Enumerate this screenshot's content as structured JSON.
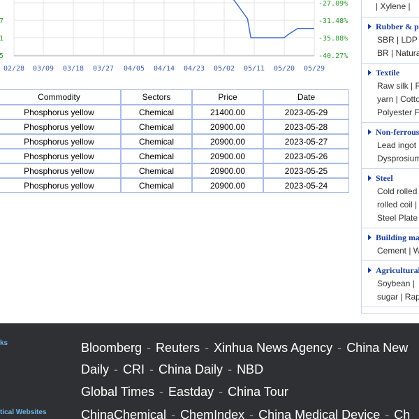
{
  "chart_data": {
    "type": "line",
    "x_ticks": [
      "02/28",
      "03/09",
      "03/18",
      "03/27",
      "04/05",
      "04/14",
      "04/23",
      "05/02",
      "05/11",
      "05/20",
      "05/29"
    ],
    "y_ticks": [
      "-27.09%",
      "-31.48%",
      "-35.88%",
      "-40.27%"
    ],
    "y_left_partial": [
      "7",
      "1",
      "5"
    ],
    "ylim": [
      -40.27,
      -27.09
    ],
    "series": [
      {
        "color": "#3f6fc9",
        "points": [
          {
            "x": "05/02",
            "y": -23.0
          },
          {
            "x": "05/09",
            "y": -31.1
          },
          {
            "x": "05/10",
            "y": -35.88
          },
          {
            "x": "05/20",
            "y": -35.88
          },
          {
            "x": "05/21",
            "y": -35.2
          },
          {
            "x": "05/24",
            "y": -33.55
          },
          {
            "x": "05/29",
            "y": -33.55
          }
        ]
      }
    ]
  },
  "table": {
    "headers": [
      "Commodity",
      "Sectors",
      "Price",
      "Date"
    ],
    "rows": [
      [
        "Phosphorus yellow",
        "Chemical",
        "21400.00",
        "2023-05-29"
      ],
      [
        "Phosphorus yellow",
        "Chemical",
        "20900.00",
        "2023-05-28"
      ],
      [
        "Phosphorus yellow",
        "Chemical",
        "20900.00",
        "2023-05-27"
      ],
      [
        "Phosphorus yellow",
        "Chemical",
        "20900.00",
        "2023-05-26"
      ],
      [
        "Phosphorus yellow",
        "Chemical",
        "20900.00",
        "2023-05-25"
      ],
      [
        "Phosphorus yellow",
        "Chemical",
        "20900.00",
        "2023-05-24"
      ]
    ]
  },
  "sidebar": {
    "top_line": "| Xylene |",
    "sections": [
      {
        "title": "Rubber & pl",
        "lines": [
          "SBR | LDP",
          "BR | Natura"
        ]
      },
      {
        "title": "Textile",
        "lines": [
          "Raw silk | F",
          "yarn | Cotto",
          "Polyester Fi"
        ]
      },
      {
        "title": "Non-ferrous",
        "lines": [
          "Lead ingot",
          "Dysprosium"
        ]
      },
      {
        "title": "Steel",
        "lines": [
          "Cold rolled s",
          "rolled coil |",
          "Steel Plate"
        ]
      },
      {
        "title": "Building ma",
        "lines": [
          "Cement | W"
        ]
      },
      {
        "title": "Agricultural",
        "lines": [
          "Soybean |",
          "sugar | Rap"
        ]
      }
    ]
  },
  "footer": {
    "label1": "ks",
    "label2": "tical Websites",
    "row1": [
      "Bloomberg",
      "Reuters",
      "Xinhua News Agency",
      "China New"
    ],
    "row2": [
      "Daily",
      "CRI",
      "China Daily",
      "NBD"
    ],
    "row3": [
      "Global Times",
      "Eastday",
      "China Tour"
    ],
    "row4": [
      "ChinaChemical",
      "ChemIndex",
      "China Medical Device",
      "Ch"
    ]
  }
}
